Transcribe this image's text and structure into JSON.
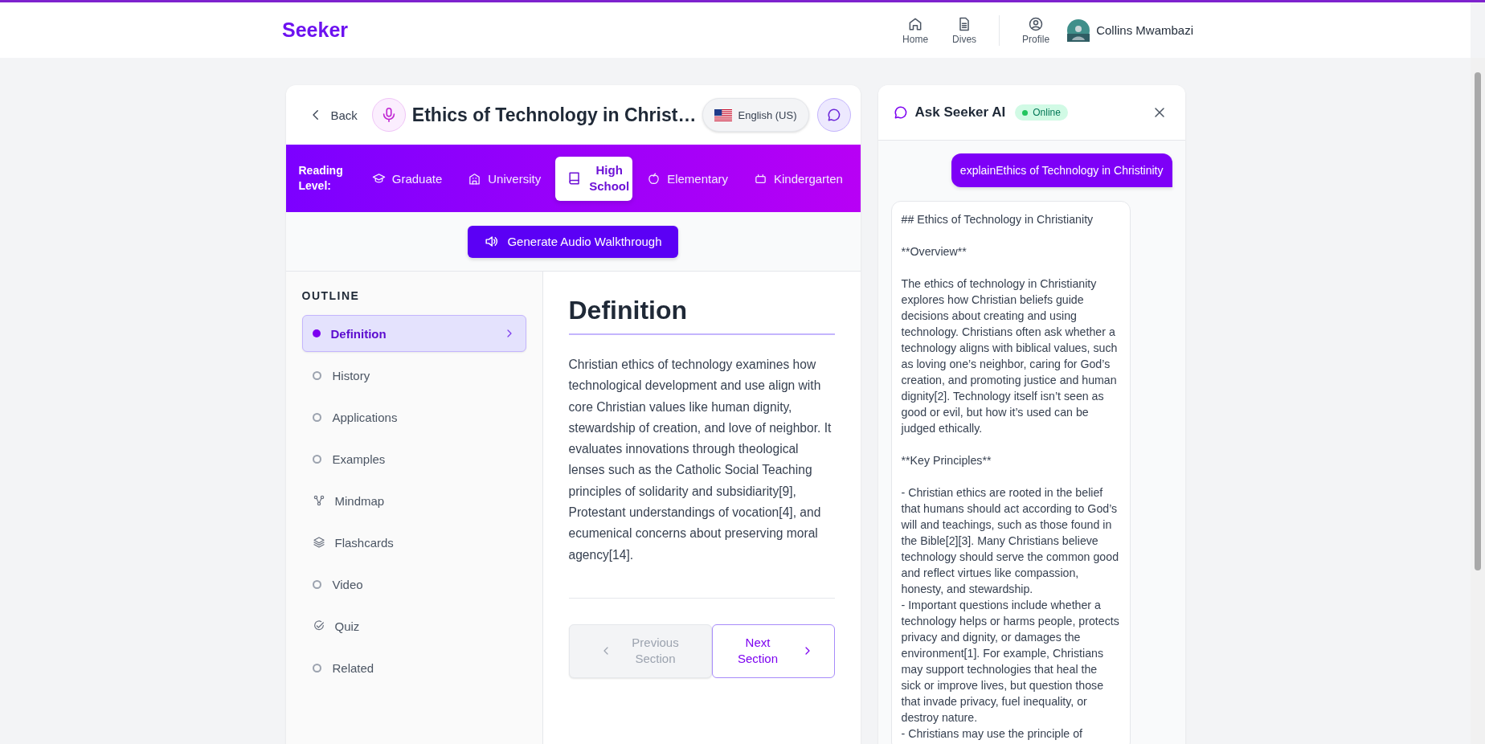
{
  "header": {
    "logo": "Seeker",
    "nav": [
      {
        "label": "Home",
        "kind": "home"
      },
      {
        "label": "Dives",
        "kind": "document"
      },
      {
        "label": "Profile",
        "kind": "profile"
      }
    ],
    "user": {
      "name": "Collins Mwambazi"
    }
  },
  "topic": {
    "back": "Back",
    "title": "Ethics of Technology in Christ…",
    "language": "English (US)"
  },
  "reading_level": {
    "label": "Reading Level:",
    "levels": [
      {
        "label": "Graduate",
        "kind": "cap",
        "selected": false
      },
      {
        "label": "University",
        "kind": "building",
        "selected": false
      },
      {
        "label": "High School",
        "kind": "book",
        "selected": true
      },
      {
        "label": "Elementary",
        "kind": "apple",
        "selected": false
      },
      {
        "label": "Kindergarten",
        "kind": "blocks",
        "selected": false
      }
    ]
  },
  "audio_button": "Generate Audio Walkthrough",
  "outline": {
    "heading": "OUTLINE",
    "items": [
      {
        "label": "Definition",
        "kind": "bullet",
        "selected": true
      },
      {
        "label": "History",
        "kind": "bullet",
        "selected": false
      },
      {
        "label": "Applications",
        "kind": "bullet",
        "selected": false
      },
      {
        "label": "Examples",
        "kind": "bullet",
        "selected": false
      },
      {
        "label": "Mindmap",
        "kind": "mindmap",
        "selected": false
      },
      {
        "label": "Flashcards",
        "kind": "layers",
        "selected": false
      },
      {
        "label": "Video",
        "kind": "bullet",
        "selected": false
      },
      {
        "label": "Quiz",
        "kind": "check",
        "selected": false
      },
      {
        "label": "Related",
        "kind": "bullet",
        "selected": false
      }
    ]
  },
  "section": {
    "title": "Definition",
    "body": "Christian ethics of technology examines how technological development and use align with core Christian values like human dignity, stewardship of creation, and love of neighbor. It evaluates innovations through theological lenses such as the Catholic Social Teaching principles of solidarity and subsidiarity[9], Protestant understandings of vocation[4], and ecumenical concerns about preserving moral agency[14].",
    "previous": {
      "label": "Previous Section",
      "disabled": true
    },
    "next": {
      "label": "Next Section",
      "disabled": false
    }
  },
  "chat": {
    "title": "Ask Seeker AI",
    "status": "Online",
    "messages": [
      {
        "kind": "user",
        "text": "explainEthics of Technology in Christinity"
      },
      {
        "kind": "assistant",
        "text": "## Ethics of Technology in Christianity\n\n**Overview**\n\nThe ethics of technology in Christianity explores how Christian beliefs guide decisions about creating and using technology. Christians often ask whether a technology aligns with biblical values, such as loving one’s neighbor, caring for God’s creation, and promoting justice and human dignity[2]. Technology itself isn’t seen as good or evil, but how it’s used can be judged ethically.\n\n**Key Principles**\n\n- Christian ethics are rooted in the belief that humans should act according to God’s will and teachings, such as those found in the Bible[2][3]. Many Christians believe technology should serve the common good and reflect virtues like compassion, honesty, and stewardship.\n- Important questions include whether a technology helps or harms people, protects privacy and dignity, or damages the environment[1]. For example, Christians may support technologies that heal the sick or improve lives, but question those that invade privacy, fuel inequality, or destroy nature.\n- Christians may use the principle of"
      }
    ]
  }
}
